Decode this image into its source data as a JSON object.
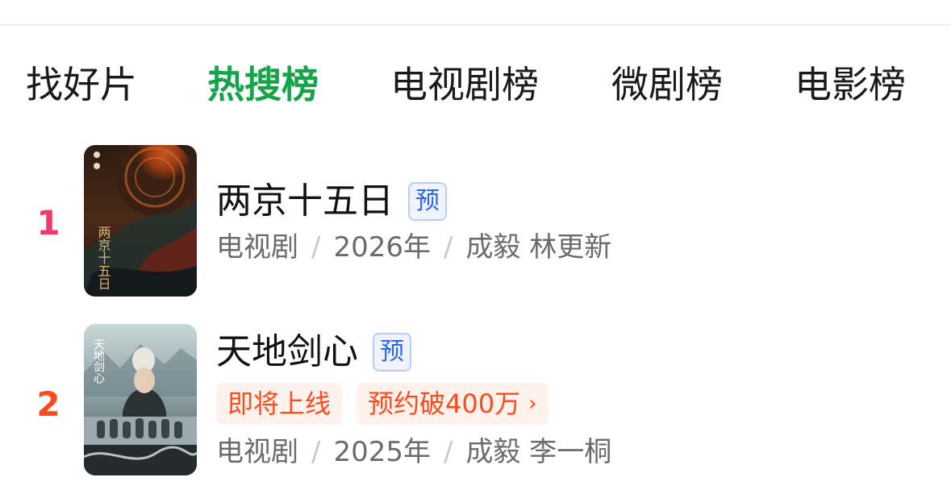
{
  "tabs": [
    {
      "label": "找好片",
      "active": false
    },
    {
      "label": "热搜榜",
      "active": true
    },
    {
      "label": "电视剧榜",
      "active": false
    },
    {
      "label": "微剧榜",
      "active": false
    },
    {
      "label": "电影榜",
      "active": false
    }
  ],
  "ranking": [
    {
      "rank": "1",
      "title": "两京十五日",
      "badge": "预",
      "poster_title": "两京十五日",
      "tags": [],
      "genre": "电视剧",
      "year": "2026年",
      "cast": "成毅 林更新"
    },
    {
      "rank": "2",
      "title": "天地剑心",
      "badge": "预",
      "poster_title": "天地剑心",
      "tags": [
        {
          "label": "即将上线"
        },
        {
          "label": "预约破400万",
          "chevron": "›"
        }
      ],
      "genre": "电视剧",
      "year": "2025年",
      "cast": "成毅 李一桐"
    }
  ],
  "separator": "/",
  "colors": {
    "active_tab": "#16a34a",
    "rank_1": "#f0386b",
    "rank_2": "#ff4a1c",
    "pre_badge_text": "#2e66e6",
    "tag_text": "#ff4a1c",
    "meta_text": "#6b6b6b"
  },
  "icons": {
    "tag_chevron": "chevron-right-icon"
  }
}
